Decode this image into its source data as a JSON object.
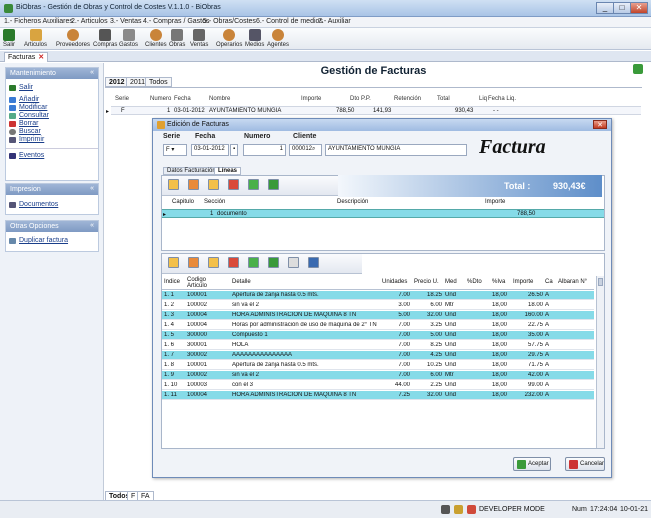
{
  "window": {
    "title": "BiObras - Gestión de Obras y Control de Costes V.1.1.0 - BiObras"
  },
  "menu": [
    "1.- Ficheros Auxiliares",
    "2.- Articulos",
    "3.- Ventas",
    "4.- Compras / Gastos",
    "5.- Obras/Costes",
    "6.- Control de medios",
    "7.- Auxiliar"
  ],
  "toolbar": [
    "Salir",
    "Articulos",
    "Proveedores",
    "Compras",
    "Gastos",
    "Clientes",
    "Obras",
    "Ventas",
    "Operarios",
    "Medios",
    "Agentes"
  ],
  "doc_tab": {
    "label": "Facturas"
  },
  "sidebar": {
    "mantenimiento": {
      "title": "Mantenimiento",
      "items": [
        "Salir",
        "Añadir",
        "Modificar",
        "Consultar",
        "Borrar",
        "Buscar",
        "Imprimir",
        "Eventos"
      ]
    },
    "impresion": {
      "title": "Impresion",
      "items": [
        "Documentos"
      ]
    },
    "otras": {
      "title": "Otras Opciones",
      "items": [
        "Duplicar factura"
      ]
    }
  },
  "main": {
    "title": "Gestión de Facturas",
    "year_tabs": [
      "2012",
      "2011",
      "Todos"
    ],
    "columns": [
      "Serie",
      "Numero",
      "Fecha",
      "Nombre",
      "Importe",
      "Dto P.P.",
      "Retención",
      "Total",
      "Liq",
      "Fecha Liq."
    ],
    "row": {
      "serie": "F",
      "numero": "1",
      "fecha": "03-01-2012",
      "nombre": "AYUNTAMIENTO MUNGIA",
      "importe": "788,50",
      "dto": "",
      "retencion": "141,93",
      "total": "930,43",
      "liq": "",
      "fecha_liq": "- -"
    },
    "bottom_tabs": [
      "Todos",
      "F",
      "FA"
    ]
  },
  "dialog": {
    "title": "Edición de Facturas",
    "header": {
      "serie_label": "Serie",
      "serie": "F",
      "fecha_label": "Fecha",
      "fecha": "03-01-2012",
      "numero_label": "Numero",
      "numero": "1",
      "cliente_label": "Cliente",
      "cliente_code": "000012",
      "cliente_name": "AYUNTAMIENTO MUNGIA"
    },
    "big_label": "Factura",
    "tabs": [
      "Datos Facturación",
      "Líneas"
    ],
    "total_label": "Total :",
    "total_value": "930,43€",
    "cap_columns": [
      "Capitulo",
      "Sección",
      "Descripción",
      "Importe"
    ],
    "cap_row": {
      "capitulo": "",
      "seccion": "1",
      "descripcion": "documento",
      "importe": "788,50"
    },
    "line_columns": [
      "Indice",
      "Codigo Articulo",
      "Detalle",
      "Unidades",
      "Precio U.",
      "Med",
      "%Dto",
      "%Iva",
      "Importe",
      "Ca",
      "Albaran N°"
    ],
    "lines": [
      {
        "indice": "1. 1",
        "codigo": "100001",
        "detalle": "Apertura de zanja hasta 0.5 mts.",
        "unidades": "7.00",
        "precio": "18.25",
        "med": "Und",
        "dto": "",
        "iva": "18,00",
        "importe": "26.50",
        "ca": "A",
        "hl": true
      },
      {
        "indice": "1. 2",
        "codigo": "100002",
        "detalle": "sin va el 2",
        "unidades": "3.00",
        "precio": "6.00",
        "med": "Mtr",
        "dto": "",
        "iva": "18,00",
        "importe": "18.00",
        "ca": "A",
        "hl": false
      },
      {
        "indice": "1. 3",
        "codigo": "100004",
        "detalle": "HORA ADMINISTRACION DE MAQUINA 8 TN",
        "unidades": "5.00",
        "precio": "32.00",
        "med": "Und",
        "dto": "",
        "iva": "18,00",
        "importe": "160.00",
        "ca": "A",
        "hl": true
      },
      {
        "indice": "1. 4",
        "codigo": "100004",
        "detalle": "Horas por administración de uso de maquina de 2° TN",
        "unidades": "7.00",
        "precio": "3.25",
        "med": "Und",
        "dto": "",
        "iva": "18,00",
        "importe": "22.75",
        "ca": "A",
        "hl": false
      },
      {
        "indice": "1. 5",
        "codigo": "300000",
        "detalle": "Compuesto 1",
        "unidades": "7.00",
        "precio": "5.00",
        "med": "Und",
        "dto": "",
        "iva": "18,00",
        "importe": "35.00",
        "ca": "A",
        "hl": true
      },
      {
        "indice": "1. 6",
        "codigo": "300001",
        "detalle": "HOLA",
        "unidades": "7.00",
        "precio": "8.25",
        "med": "Und",
        "dto": "",
        "iva": "18,00",
        "importe": "57.75",
        "ca": "A",
        "hl": false
      },
      {
        "indice": "1. 7",
        "codigo": "300002",
        "detalle": "AAAAAAAAAAAAAAA",
        "unidades": "7.00",
        "precio": "4.25",
        "med": "Und",
        "dto": "",
        "iva": "18,00",
        "importe": "29.75",
        "ca": "A",
        "hl": true
      },
      {
        "indice": "1. 8",
        "codigo": "100001",
        "detalle": "Apertura de zanja hasta 0.5 mts.",
        "unidades": "7.00",
        "precio": "10.25",
        "med": "Und",
        "dto": "",
        "iva": "18,00",
        "importe": "71.75",
        "ca": "A",
        "hl": false
      },
      {
        "indice": "1. 9",
        "codigo": "100002",
        "detalle": "sin va el 2",
        "unidades": "7.00",
        "precio": "6.00",
        "med": "Mtr",
        "dto": "",
        "iva": "18,00",
        "importe": "42.00",
        "ca": "A",
        "hl": true
      },
      {
        "indice": "1. 10",
        "codigo": "100003",
        "detalle": "con el 3",
        "unidades": "44.00",
        "precio": "2.25",
        "med": "Und",
        "dto": "",
        "iva": "18,00",
        "importe": "99.00",
        "ca": "A",
        "hl": false
      },
      {
        "indice": "1. 11",
        "codigo": "100004",
        "detalle": "HORA ADMINISTRACION DE MAQUINA 8 TN",
        "unidades": "7.25",
        "precio": "32.00",
        "med": "Und",
        "dto": "",
        "iva": "18,00",
        "importe": "232.00",
        "ca": "A",
        "hl": true
      }
    ],
    "accept_label": "Aceptar",
    "cancel_label": "Cancelar"
  },
  "status": {
    "mode": "DEVELOPER MODE",
    "num": "Num",
    "time": "17:24:04",
    "date": "10-01-21"
  },
  "colors": {
    "highlight": "#86dbe8",
    "accent": "#5e8ec9"
  }
}
